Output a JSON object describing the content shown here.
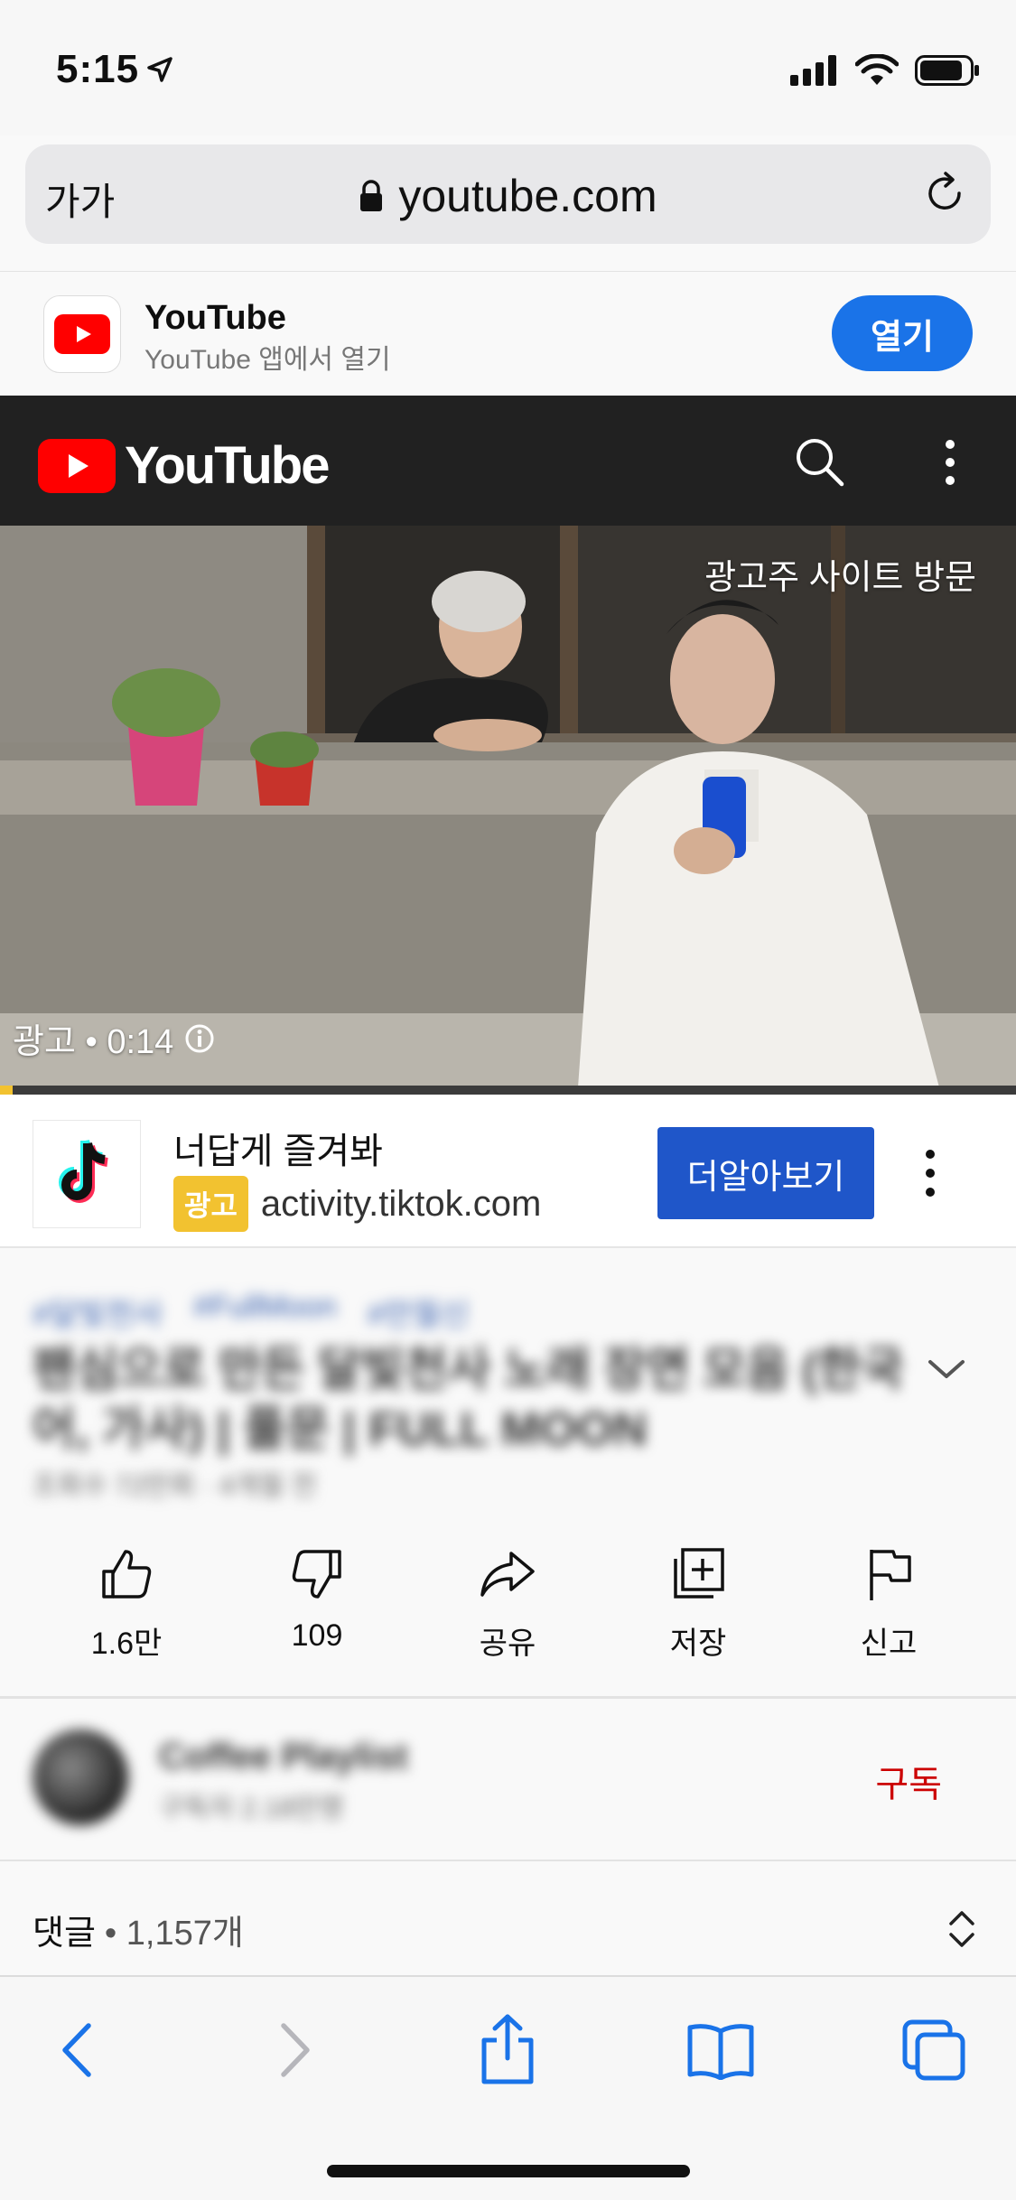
{
  "status_bar": {
    "time": "5:15"
  },
  "browser": {
    "text_size_label": "가가",
    "url": "youtube.com"
  },
  "app_banner": {
    "name": "YouTube",
    "subtitle": "YouTube 앱에서 열기",
    "open_label": "열기"
  },
  "header": {
    "logo_text": "YouTube"
  },
  "video": {
    "visit_advertiser": "광고주 사이트 방문",
    "ad_time": "광고 • 0:14",
    "progress": 0.012
  },
  "ad": {
    "title": "너답게 즐겨봐",
    "badge": "광고",
    "domain": "activity.tiktok.com",
    "cta": "더알아보기"
  },
  "video_info": {
    "tags": [
      "#달빛천사",
      "#FullMoon",
      "#만월신"
    ],
    "title": "팬심으로 만든 달빛천사 노래 장면 모음 (한국어, 가사) | 풀문 | FULL MOON",
    "meta": "조회수 72만회 · 4개월 전"
  },
  "actions": [
    {
      "icon": "thumbs-up-icon",
      "label": "1.6만"
    },
    {
      "icon": "thumbs-down-icon",
      "label": "109"
    },
    {
      "icon": "share-icon",
      "label": "공유"
    },
    {
      "icon": "save-icon",
      "label": "저장"
    },
    {
      "icon": "flag-icon",
      "label": "신고"
    }
  ],
  "channel": {
    "name": "Coffee Playlist",
    "subscribers": "구독자 2.18만명",
    "subscribe_label": "구독"
  },
  "comments": {
    "label": "댓글",
    "count": "• 1,157개"
  },
  "colors": {
    "youtube_red": "#ff0000",
    "ios_blue": "#1a73e8",
    "ad_yellow": "#f2c230",
    "cta_blue": "#1f56c9",
    "subscribe_red": "#cc0000"
  }
}
